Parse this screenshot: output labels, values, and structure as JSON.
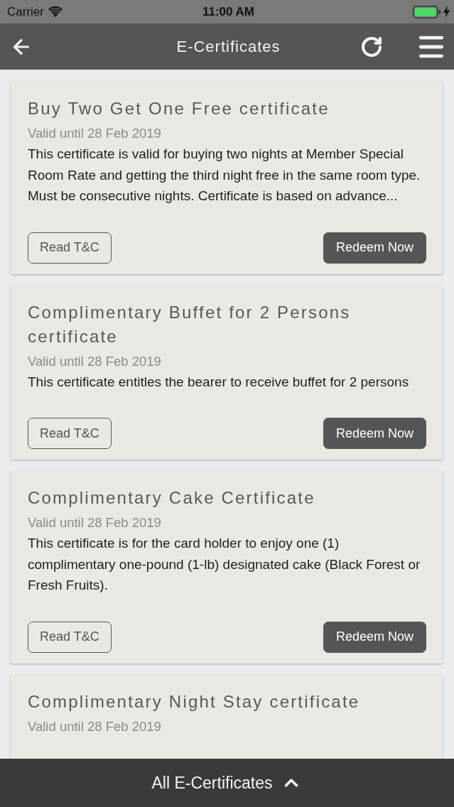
{
  "status_bar": {
    "carrier": "Carrier",
    "time": "11:00 AM"
  },
  "nav_bar": {
    "title": "E-Certificates"
  },
  "certificates": [
    {
      "title": "Buy Two Get One Free certificate",
      "validity": "Valid until 28 Feb 2019",
      "description": "This certificate is valid for buying two nights at Member Special Room Rate and getting the third night free in the same room type. Must be consecutive nights. Certificate is based on advance...",
      "buttons": [
        {
          "label": "Read T&C",
          "kind": "outline"
        },
        {
          "label": "Redeem Now",
          "kind": "filled"
        }
      ]
    },
    {
      "title": "Complimentary Buffet for 2 Persons certificate",
      "validity": "Valid until 28 Feb 2019",
      "description": "This certificate entitles the bearer to receive buffet for 2 persons",
      "buttons": [
        {
          "label": "Read T&C",
          "kind": "outline"
        },
        {
          "label": "Redeem Now",
          "kind": "filled"
        }
      ]
    },
    {
      "title": "Complimentary Cake Certificate",
      "validity": "Valid until 28 Feb 2019",
      "description": "This certificate is for the card holder to enjoy one (1) complimentary one-pound (1-lb) designated cake (Black Forest or Fresh Fruits).",
      "buttons": [
        {
          "label": "Read T&C",
          "kind": "outline"
        },
        {
          "label": "Redeem Now",
          "kind": "filled"
        }
      ]
    },
    {
      "title": "Complimentary Night Stay certificate",
      "validity": "Valid until 28 Feb 2019"
    }
  ],
  "footer": {
    "label": "All E-Certificates"
  }
}
